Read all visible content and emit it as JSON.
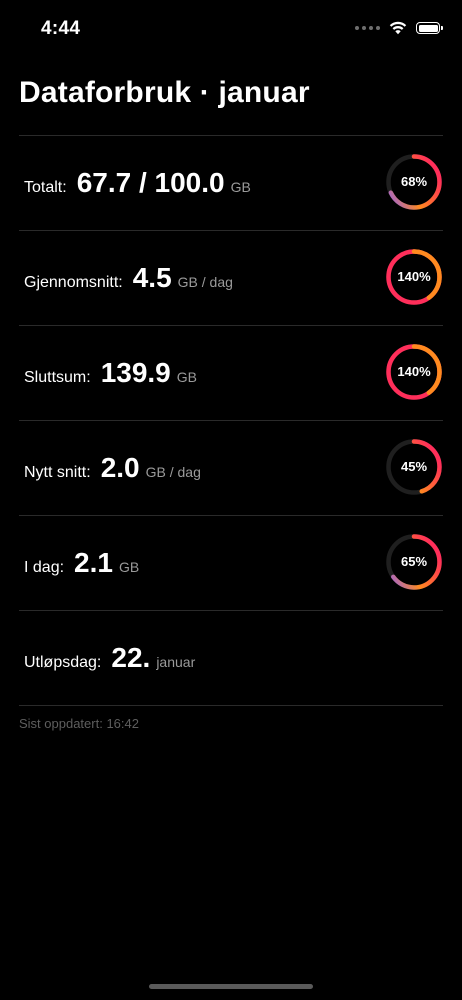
{
  "status_bar": {
    "time": "4:44"
  },
  "title": "Dataforbruk · januar",
  "colors": {
    "ring_track": "#1f1f1f",
    "grad_start": "#8e5cf6",
    "grad_mid": "#ff8a1f",
    "grad_end": "#ff2e5a"
  },
  "rows": [
    {
      "label": "Totalt:",
      "value": "67.7 / 100.0",
      "unit": "GB",
      "ring_label": "68%",
      "ring_percent": 68
    },
    {
      "label": "Gjennomsnitt:",
      "value": "4.5",
      "unit": "GB / dag",
      "ring_label": "140%",
      "ring_percent": 140
    },
    {
      "label": "Sluttsum:",
      "value": "139.9",
      "unit": "GB",
      "ring_label": "140%",
      "ring_percent": 140
    },
    {
      "label": "Nytt snitt:",
      "value": "2.0",
      "unit": "GB / dag",
      "ring_label": "45%",
      "ring_percent": 45
    },
    {
      "label": "I dag:",
      "value": "2.1",
      "unit": "GB",
      "ring_label": "65%",
      "ring_percent": 65
    },
    {
      "label": "Utløpsdag:",
      "value": "22.",
      "unit": "januar",
      "ring_label": null,
      "ring_percent": null
    }
  ],
  "footer": "Sist oppdatert: 16:42"
}
